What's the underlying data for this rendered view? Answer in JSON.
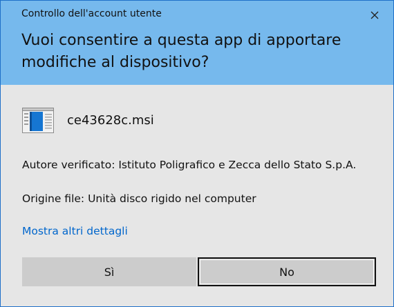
{
  "window": {
    "title": "Controllo dell'account utente",
    "close_icon": "close-icon"
  },
  "question": "Vuoi consentire a questa app di apportare modifiche al dispositivo?",
  "file": {
    "icon": "installer-window-icon",
    "name": "ce43628c.msi"
  },
  "publisher": "Autore verificato: Istituto Poligrafico e Zecca dello Stato S.p.A.",
  "origin": "Origine file: Unità disco rigido nel computer",
  "details_link": "Mostra altri dettagli",
  "buttons": {
    "yes": "Sì",
    "no": "No"
  },
  "colors": {
    "header": "#76b9ed",
    "body": "#e6e6e6",
    "link": "#0066cc",
    "button": "#cccccc"
  }
}
